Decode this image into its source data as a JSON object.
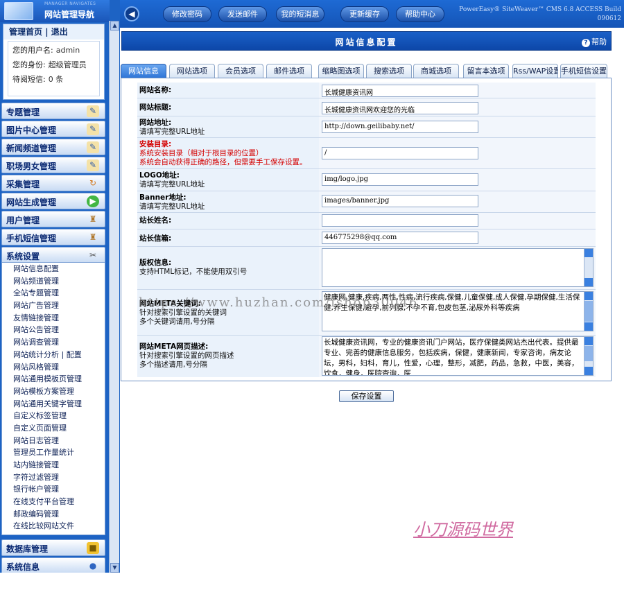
{
  "sidebar": {
    "logo_sub": "MANAGER NAVIGATES",
    "logo_title": "网站管理导航",
    "quick_links": [
      "管理首页",
      "退出"
    ],
    "user_info": [
      {
        "label": "您的用户名:",
        "value": "admin"
      },
      {
        "label": "您的身份:",
        "value": "超级管理员"
      },
      {
        "label": "待阅短信:",
        "value": "0 条"
      }
    ],
    "categories_top": [
      {
        "label": "专题管理",
        "icon": "edit-icon"
      },
      {
        "label": "图片中心管理",
        "icon": "edit-icon"
      },
      {
        "label": "新闻频道管理",
        "icon": "edit-icon"
      },
      {
        "label": "职场男女管理",
        "icon": "edit-icon"
      },
      {
        "label": "采集管理",
        "icon": "refresh-icon"
      },
      {
        "label": "网站生成管理",
        "icon": "play-icon"
      },
      {
        "label": "用户管理",
        "icon": "user-icon"
      },
      {
        "label": "手机短信管理",
        "icon": "user-icon"
      },
      {
        "label": "系统设置",
        "icon": "tools-icon"
      }
    ],
    "system_items": [
      "网站信息配置",
      "网站频道管理",
      "全站专题管理",
      "网站广告管理",
      "友情链接管理",
      "网站公告管理",
      "网站调查管理",
      "网站统计分析 | 配置",
      "网站风格管理",
      "网站通用模板页管理",
      "网站模板方案管理",
      "网站通用关键字管理",
      "自定义标签管理",
      "自定义页面管理",
      "网站日志管理",
      "管理员工作量统计",
      "站内链接管理",
      "字符过滤管理",
      "银行帐户管理",
      "在线支付平台管理",
      "邮政编码管理",
      "在线比较网站文件"
    ],
    "categories_bottom": [
      {
        "label": "数据库管理",
        "icon": "lock-icon"
      },
      {
        "label": "系统信息",
        "icon": "info-icon"
      }
    ]
  },
  "topbar": {
    "buttons": [
      "修改密码",
      "发送邮件",
      "我的短消息",
      "更新缓存",
      "帮助中心"
    ],
    "version_line1": "PowerEasy® SiteWeaver™ CMS 6.8 ACCESS Build",
    "version_line2": "090612"
  },
  "page": {
    "title": "网站信息配置",
    "help": "帮助"
  },
  "tabs": [
    "网站信息",
    "网站选项",
    "会员选项",
    "邮件选项",
    "缩略图选项",
    "搜索选项",
    "商城选项",
    "留言本选项",
    "Rss/WAP设置",
    "手机短信设置"
  ],
  "form": {
    "rows": [
      {
        "label": "网站名称:",
        "value": "长城健康资讯网"
      },
      {
        "label": "网站标题:",
        "value": "长城健康资讯网欢迎您的光临"
      },
      {
        "label": "网站地址:",
        "hint": "请填写完整URL地址",
        "value": "http://down.geilibaby.net/"
      },
      {
        "label": "安装目录:",
        "hint": "系统安装目录（相对于根目录的位置）",
        "hint2": "系统会自动获得正确的路径，但需要手工保存设置。",
        "value": "/"
      },
      {
        "label": "LOGO地址:",
        "hint": "请填写完整URL地址",
        "value": "img/logo.jpg"
      },
      {
        "label": "Banner地址:",
        "hint": "请填写完整URL地址",
        "value": "images/banner.jpg"
      },
      {
        "label": "站长姓名:",
        "value": ""
      },
      {
        "label": "站长信箱:",
        "value": "446775298@qq.com"
      },
      {
        "label": "版权信息:",
        "hint": "支持HTML标记，不能使用双引号",
        "value": ""
      },
      {
        "label": "网站META关键词:",
        "hint": "针对搜索引擎设置的关键词",
        "hint2": "多个关键词请用,号分隔",
        "value": "健康网,健康,疾病,两性,性病,流行疾病,保健,儿童保健,成人保健,孕期保健,生活保健,养生保健,避孕,前列腺,不孕不育,包皮包茎,泌尿外科等疾病"
      },
      {
        "label": "网站META网页描述:",
        "hint": "针对搜索引擎设置的网页描述",
        "hint2": "多个描述请用,号分隔",
        "value": "长城健康资讯网，专业的健康资讯门户网站，医疗保健类网站杰出代表。提供最专业、完善的健康信息服务，包括疾病，保健，健康新闻，专家咨询，病友论坛，男科，妇科，育儿，性爱，心理，整形，减肥，药品，急救，中医，美容，饮食，健身，医院查询，医"
      }
    ],
    "save_label": "保存设置"
  },
  "overlay": {
    "watermark": "https://www.huzhan.com/ishop30046",
    "signature": "小刀源码世界"
  },
  "colors": {
    "sidebar_bg": "#1d63c4",
    "header_bg": "#1454b6",
    "required_label": "#d40000",
    "active_tab": "#2c73d6"
  }
}
